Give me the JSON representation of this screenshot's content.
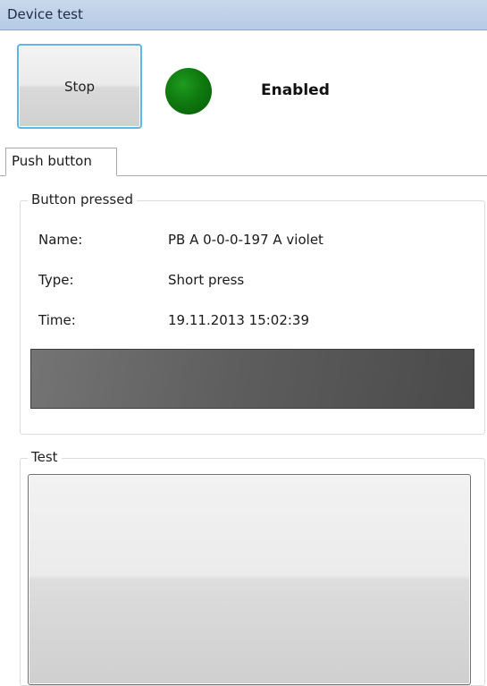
{
  "window": {
    "title": "Device test"
  },
  "controls": {
    "stop_label": "Stop",
    "status_text": "Enabled",
    "status_color": "#0f7a0f"
  },
  "tabs": [
    {
      "label": "Push button",
      "selected": true
    }
  ],
  "button_pressed": {
    "legend": "Button pressed",
    "fields": [
      {
        "label": "Name:",
        "value": "PB A 0-0-0-197 A violet"
      },
      {
        "label": "Type:",
        "value": "Short press"
      },
      {
        "label": "Time:",
        "value": "19.11.2013 15:02:39"
      }
    ],
    "color_swatch": "#5e5e5e"
  },
  "test": {
    "legend": "Test"
  }
}
